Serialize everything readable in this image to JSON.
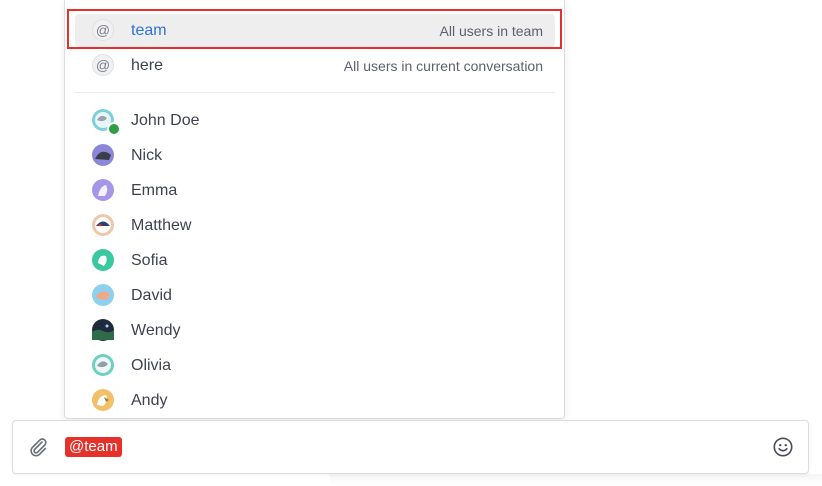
{
  "mention_popup": {
    "groups": [
      {
        "symbol": "@",
        "name": "team",
        "description": "All users in team",
        "selected": true
      },
      {
        "symbol": "@",
        "name": "here",
        "description": "All users in current conversation",
        "selected": false
      }
    ],
    "users": [
      {
        "name": "John Doe",
        "online": true,
        "avatar_icon": "avatar-john-doe"
      },
      {
        "name": "Nick",
        "online": false,
        "avatar_icon": "avatar-nick"
      },
      {
        "name": "Emma",
        "online": false,
        "avatar_icon": "avatar-emma"
      },
      {
        "name": "Matthew",
        "online": false,
        "avatar_icon": "avatar-matthew"
      },
      {
        "name": "Sofia",
        "online": false,
        "avatar_icon": "avatar-sofia"
      },
      {
        "name": "David",
        "online": false,
        "avatar_icon": "avatar-david"
      },
      {
        "name": "Wendy",
        "online": false,
        "avatar_icon": "avatar-wendy"
      },
      {
        "name": "Olivia",
        "online": false,
        "avatar_icon": "avatar-olivia"
      },
      {
        "name": "Andy",
        "online": false,
        "avatar_icon": "avatar-andy"
      }
    ]
  },
  "composer": {
    "mention_text": "@team",
    "attach_icon": "paperclip-icon",
    "emoji_icon": "smiley-icon"
  },
  "colors": {
    "accent_blue": "#2f73d3",
    "mention_red": "#e5312a",
    "online_green": "#2ea043"
  }
}
